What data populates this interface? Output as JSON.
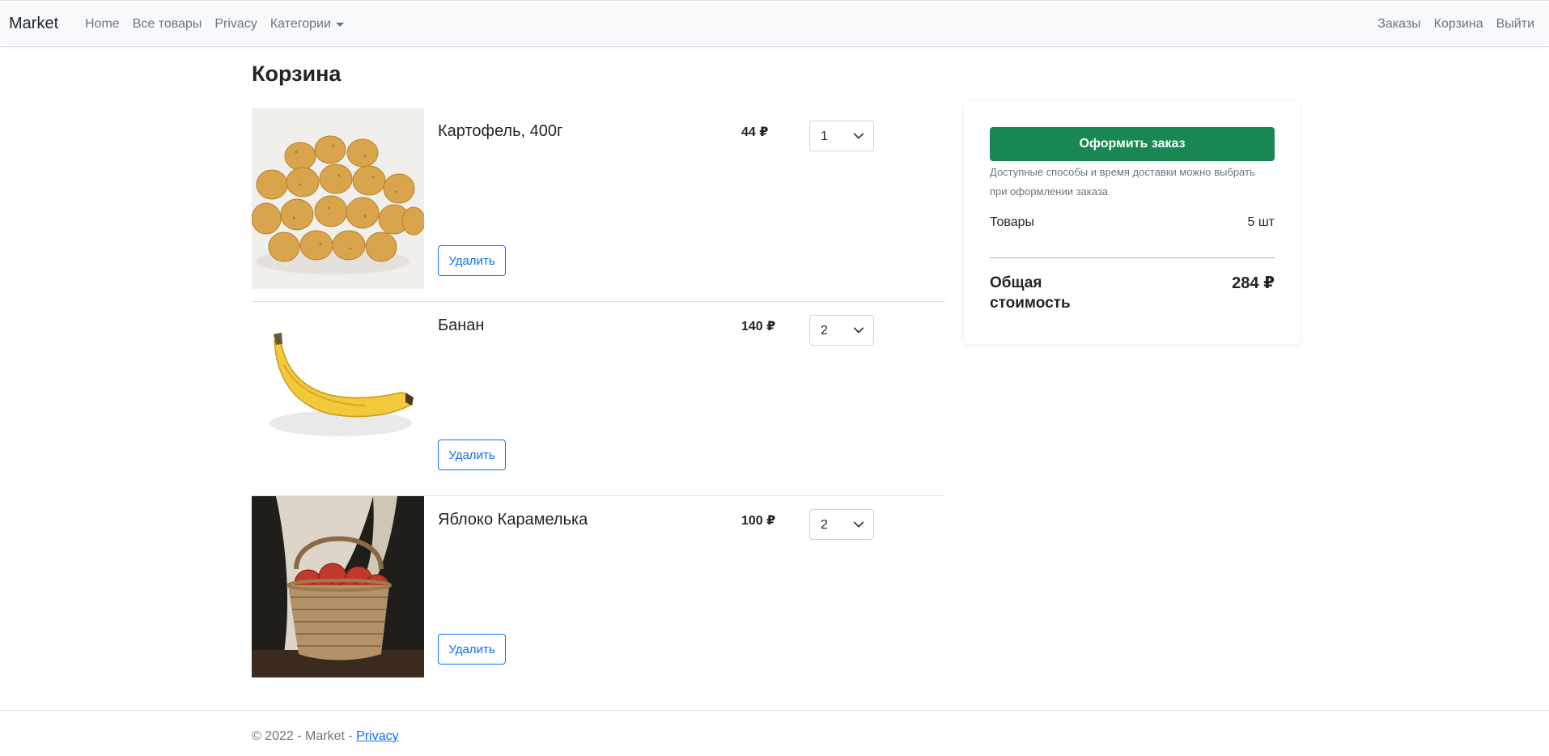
{
  "navbar": {
    "brand": "Market",
    "left_links": [
      "Home",
      "Все товары",
      "Privacy"
    ],
    "categories_label": "Категории",
    "right_links": [
      "Заказы",
      "Корзина",
      "Выйти"
    ]
  },
  "cart": {
    "title": "Корзина",
    "remove_label": "Удалить",
    "items": [
      {
        "name": "Картофель, 400г",
        "price": "44 ₽",
        "quantity": "1",
        "image": "potatoes-photo"
      },
      {
        "name": "Банан",
        "price": "140 ₽",
        "quantity": "2",
        "image": "banana-photo"
      },
      {
        "name": "Яблоко Карамелька",
        "price": "100 ₽",
        "quantity": "2",
        "image": "apple-basket-photo"
      }
    ]
  },
  "summary": {
    "checkout_label": "Оформить заказ",
    "delivery_note": "Доступные способы и время доставки можно выбрать при оформлении заказа",
    "goods_label": "Товары",
    "goods_value": "5 шт",
    "total_label": "Общая стоимость",
    "total_value": "284 ₽"
  },
  "footer": {
    "text": "© 2022 - Market - ",
    "link": "Privacy"
  },
  "colors": {
    "primary": "#0d6efd",
    "success": "#198754",
    "navbar_bg": "#f8f9fa",
    "muted": "#6c757d"
  }
}
